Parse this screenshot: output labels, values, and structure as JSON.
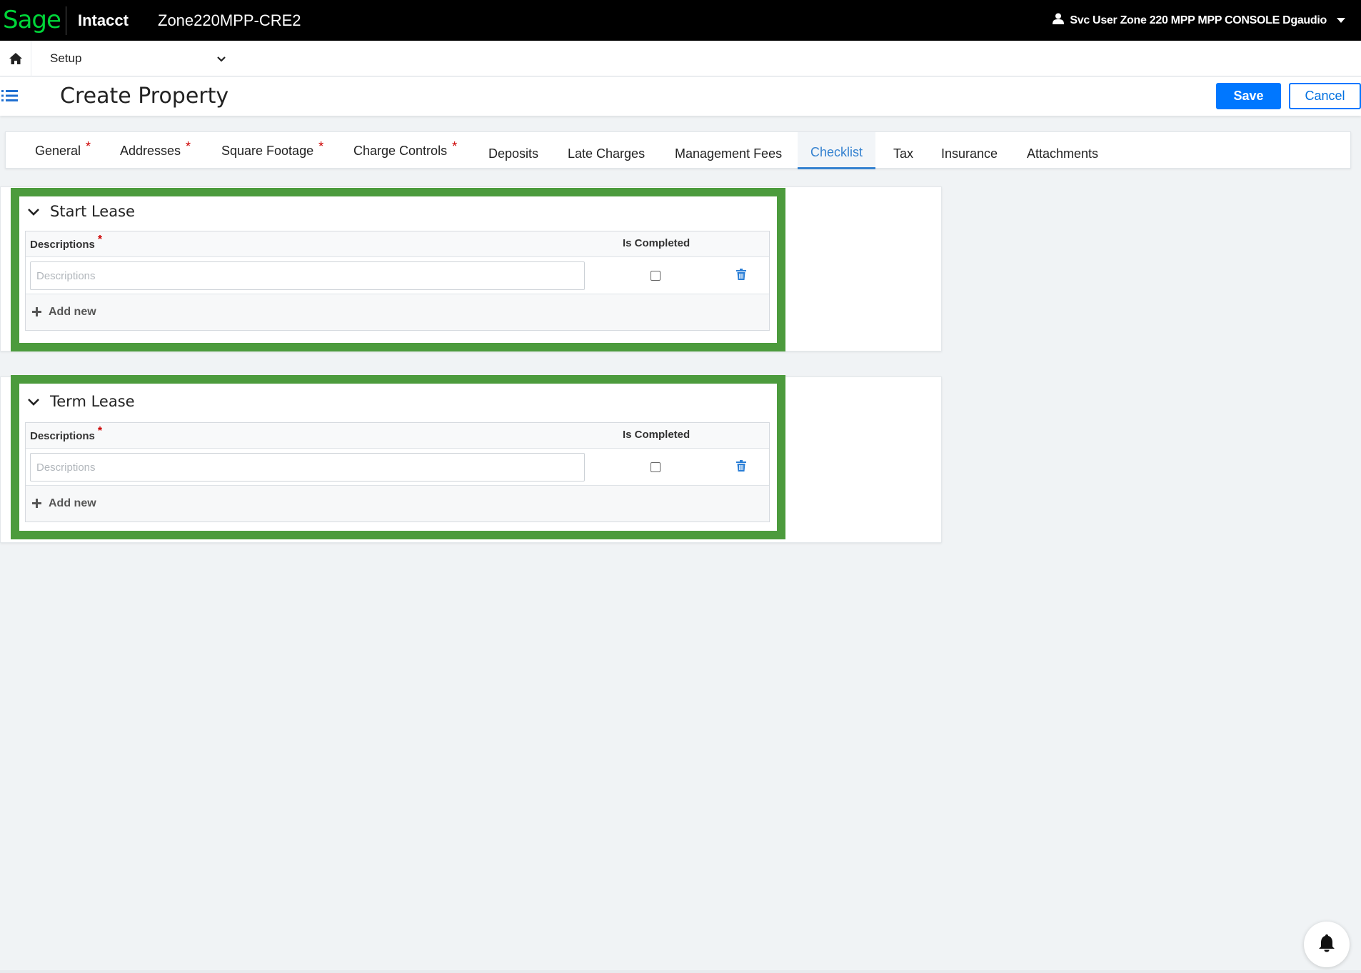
{
  "topbar": {
    "logo": "Sage",
    "product": "Intacct",
    "company": "Zone220MPP-CRE2",
    "user": "Svc User Zone 220 MPP MPP CONSOLE Dgaudio"
  },
  "menubar": {
    "module": "Setup"
  },
  "header": {
    "title": "Create Property",
    "save_label": "Save",
    "cancel_label": "Cancel"
  },
  "tabs": [
    {
      "label": "General",
      "required": "*"
    },
    {
      "label": "Addresses",
      "required": "*"
    },
    {
      "label": "Square Footage",
      "required": "*"
    },
    {
      "label": "Charge Controls",
      "required": "*"
    },
    {
      "label": "Deposits"
    },
    {
      "label": "Late Charges"
    },
    {
      "label": "Management Fees"
    },
    {
      "label": "Checklist",
      "active": true
    },
    {
      "label": "Tax"
    },
    {
      "label": "Insurance"
    },
    {
      "label": "Attachments"
    }
  ],
  "sections": [
    {
      "title": "Start Lease",
      "col_descriptions": "Descriptions",
      "required": "*",
      "col_completed": "Is Completed",
      "row_placeholder": "Descriptions",
      "add_new": "Add new"
    },
    {
      "title": "Term Lease",
      "col_descriptions": "Descriptions",
      "required": "*",
      "col_completed": "Is Completed",
      "row_placeholder": "Descriptions",
      "add_new": "Add new"
    }
  ],
  "colors": {
    "accent": "#0077ff",
    "highlight": "#4c9b3d",
    "required": "#cc0000",
    "brand": "#00d639"
  }
}
